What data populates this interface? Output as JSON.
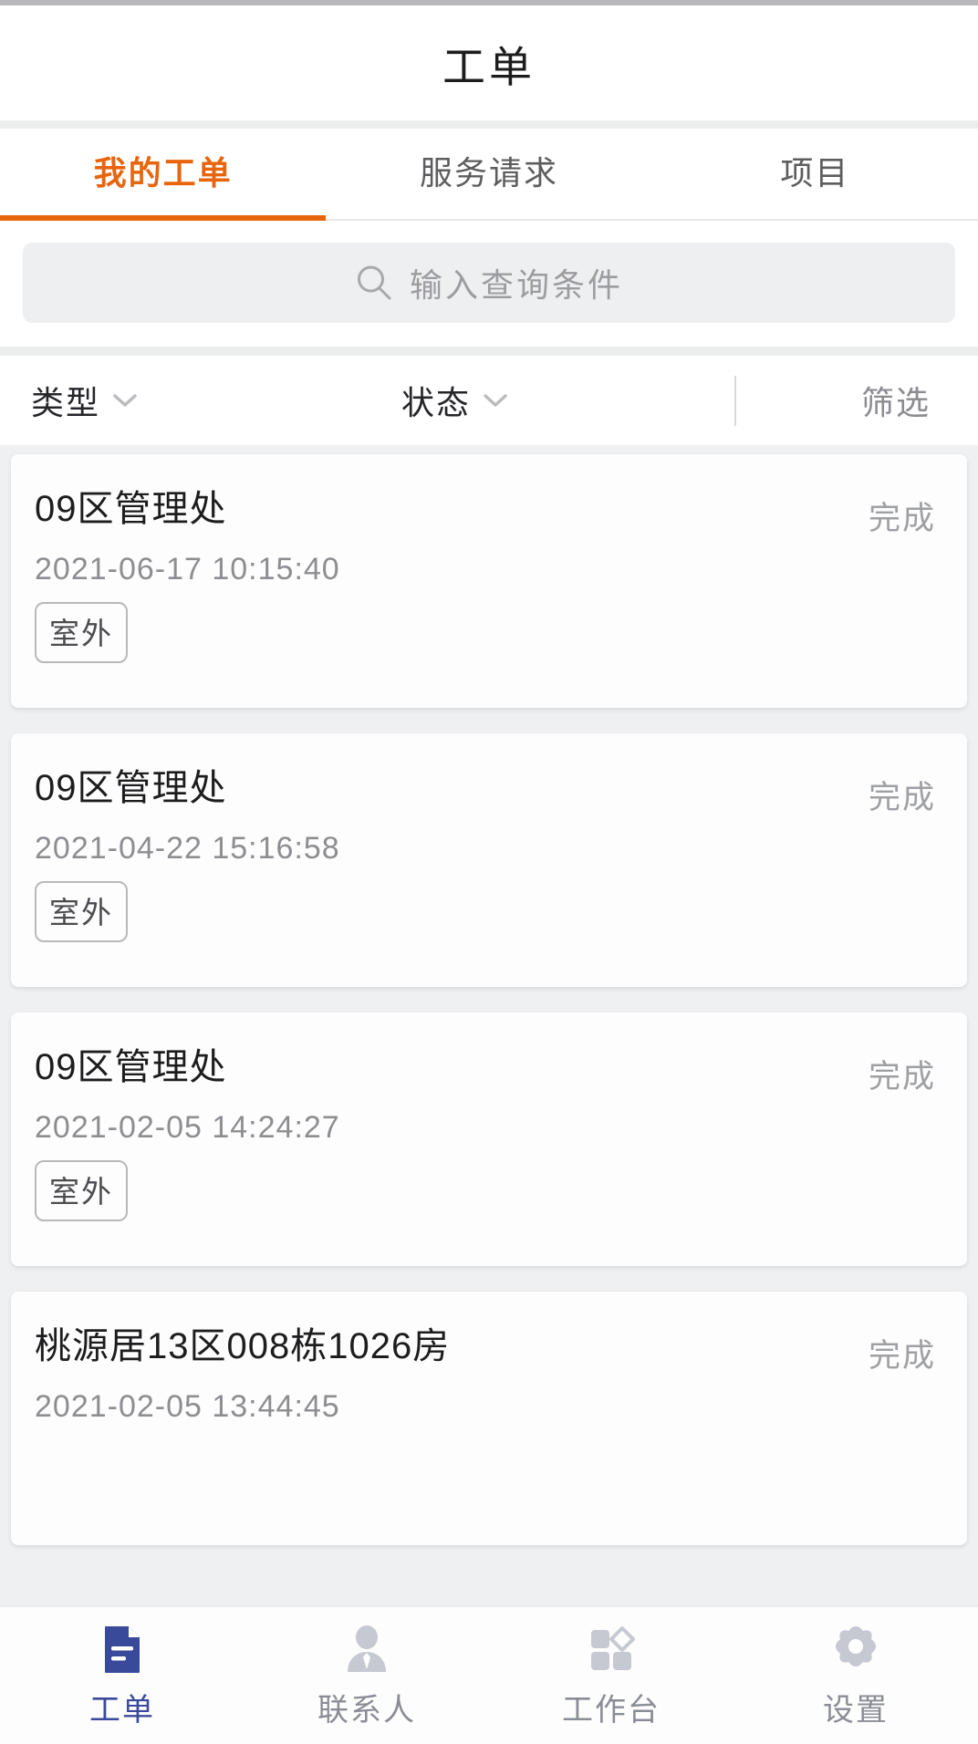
{
  "header": {
    "title": "工单"
  },
  "tabs": {
    "items": [
      {
        "label": "我的工单",
        "active": true
      },
      {
        "label": "服务请求",
        "active": false
      },
      {
        "label": "项目",
        "active": false
      }
    ],
    "active_color": "#e8650d"
  },
  "search": {
    "placeholder": "输入查询条件",
    "icon": "search-icon",
    "value": ""
  },
  "filter_bar": {
    "type_label": "类型",
    "type_icon": "chevron-down-icon",
    "state_label": "状态",
    "state_icon": "chevron-down-icon",
    "screen_label": "筛选"
  },
  "list": {
    "cards": [
      {
        "title": "09区管理处",
        "date": "2021-06-17 10:15:40",
        "tag": "室外",
        "status": "完成"
      },
      {
        "title": "09区管理处",
        "date": "2021-04-22 15:16:58",
        "tag": "室外",
        "status": "完成"
      },
      {
        "title": "09区管理处",
        "date": "2021-02-05 14:24:27",
        "tag": "室外",
        "status": "完成"
      },
      {
        "title": "桃源居13区008栋1026房",
        "date": "2021-02-05 13:44:45",
        "tag": "",
        "status": "完成"
      }
    ]
  },
  "bottom_nav": {
    "items": [
      {
        "label": "工单",
        "icon": "document-icon",
        "active": true
      },
      {
        "label": "联系人",
        "icon": "person-icon",
        "active": false
      },
      {
        "label": "工作台",
        "icon": "workbench-icon",
        "active": false
      },
      {
        "label": "设置",
        "icon": "gear-icon",
        "active": false
      }
    ],
    "active_color": "#3a4a9a",
    "inactive_color": "#c6c9d2"
  }
}
